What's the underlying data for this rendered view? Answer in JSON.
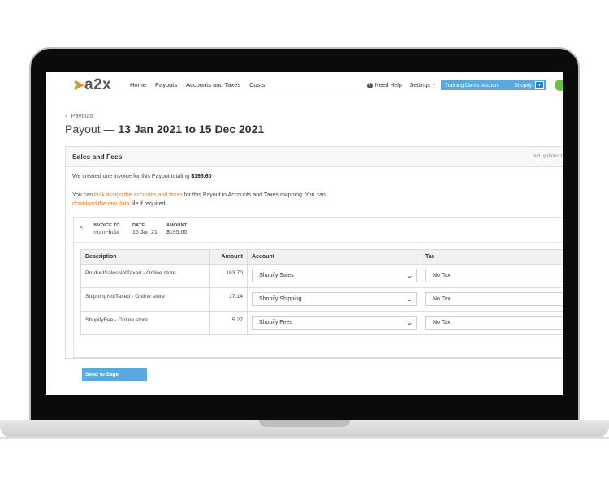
{
  "nav": {
    "logo_text": "a2x",
    "links": [
      "Home",
      "Payouts",
      "Accounts and Taxes",
      "Costs"
    ],
    "help_label": "Need Help",
    "settings_label": "Settings",
    "account_name": "Training Demo Account",
    "account_platform": "Shopify"
  },
  "header": {
    "breadcrumb": "Payouts",
    "title_prefix": "Payout —",
    "title_range": "13 Jan 2021 to 15 Dec 2021"
  },
  "card": {
    "title": "Sales and Fees",
    "last_updated": "last updated t",
    "invoice_text": "We created one invoice for this Payout totaling",
    "invoice_total": "$195.60",
    "bulk_pre": "You can",
    "bulk_link": "bulk assign the accounts and taxes",
    "bulk_post": "for this Payout in Accounts and Taxes mapping. You",
    "download_pre": "can",
    "download_link": "download the raw data",
    "download_post": "file if required."
  },
  "invoice": {
    "invoice_to_label": "INVOICE TO",
    "invoice_to": "mumi-bubi",
    "date_label": "DATE",
    "date": "15 Jan 21",
    "amount_label": "AMOUNT",
    "amount": "$195.60"
  },
  "table": {
    "headers": [
      "Description",
      "Amount",
      "Account",
      "Tax"
    ],
    "rows": [
      {
        "description": "ProductSalesNotTaxed - Online store",
        "amount": "183.70",
        "account": "Shopify Sales",
        "tax": "No Tax"
      },
      {
        "description": "ShippingNotTaxed - Online store",
        "amount": "17.14",
        "account": "Shopify Shipping",
        "tax": "No Tax"
      },
      {
        "description": "ShopifyFee - Online store",
        "amount": "5.27",
        "account": "Shopify Fees",
        "tax": "No Tax"
      }
    ]
  },
  "actions": {
    "send_label": "Send to Sage"
  },
  "colors": {
    "accent": "#5aa9dd",
    "link": "#e07a1f",
    "avatar": "#6cc04a"
  }
}
